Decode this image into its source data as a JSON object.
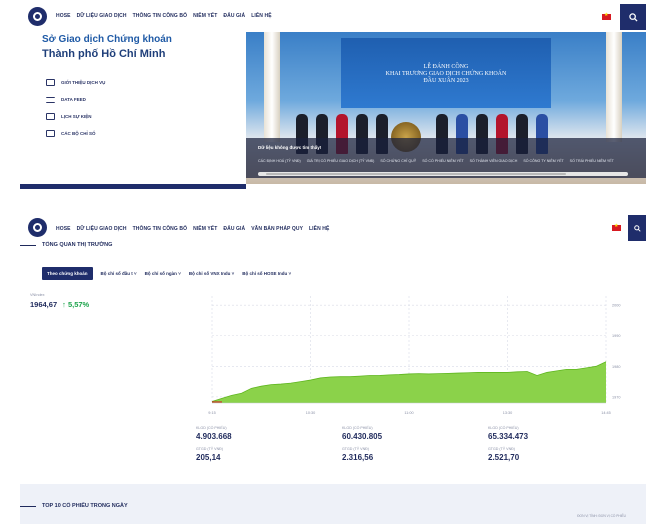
{
  "top": {
    "nav": [
      "HOSE",
      "DỮ LIỆU GIAO DỊCH",
      "THÔNG TIN CÔNG BỐ",
      "NIÊM YẾT",
      "ĐẤU GIÁ",
      "LIÊN HỆ"
    ],
    "hero_title_1": "Sở Giao dịch Chứng khoán",
    "hero_title_2": "Thành phố Hồ Chí Minh",
    "menu": [
      "GIỚI THIỆU DỊCH VỤ",
      "DATA FEED",
      "LỊCH SỰ KIỆN",
      "CÁC BỘ CHỈ SỐ"
    ],
    "photo_banner_line1": "LỄ ĐÁNH CỒNG",
    "photo_banner_line2": "KHAI TRƯƠNG GIAO DỊCH CHỨNG KHOÁN",
    "photo_banner_line3": "ĐẦU XUÂN 2023",
    "caption_title": "Dữ liệu không được tìm thấy!",
    "caption_items": [
      "CÁC ĐỊNH HOÁ (TỶ VNĐ)",
      "GIÁ TRỊ CỔ PHIẾU GIAO DỊCH (TỶ VNĐ)",
      "SỐ CHỨNG CHỈ QUỸ",
      "SỐ CỔ PHIẾU NIÊM YẾT",
      "SỐ THÀNH VIÊN GIAO DỊCH",
      "SỐ CÔNG TY NIÊM YẾT",
      "SỐ TRÁI PHIẾU NIÊM YẾT"
    ]
  },
  "bottom": {
    "nav": [
      "HOSE",
      "DỮ LIỆU GIAO DỊCH",
      "THÔNG TIN CÔNG BỐ",
      "NIÊM YẾT",
      "ĐẤU GIÁ",
      "VĂN BẢN PHÁP QUY",
      "LIÊN HỆ"
    ],
    "section_title": "TỔNG QUAN THỊ TRƯỜNG",
    "tabs": [
      "Theo chứng khoán",
      "Bộ chỉ số đầu t",
      "Bộ chỉ số ngàn",
      "Bộ chỉ số VNX Indu",
      "Bộ chỉ số HOSE Indu"
    ],
    "index_label": "VNIndex",
    "index_value": "1964,67",
    "index_change": "↑ 5,57%",
    "stats": [
      {
        "label": "KLGD (CỔ PHIẾU)",
        "value": "4.903.668"
      },
      {
        "label": "KLGD (CỔ PHIẾU)",
        "value": "60.430.805"
      },
      {
        "label": "KLGD (CỔ PHIẾU)",
        "value": "65.334.473"
      },
      {
        "label": "GTGD (TỶ VNĐ)",
        "value": "205,14"
      },
      {
        "label": "GTGD (TỶ VNĐ)",
        "value": "2.316,56"
      },
      {
        "label": "GTGD (TỶ VNĐ)",
        "value": "2.521,70"
      }
    ],
    "top10_title": "TOP 10 CỔ PHIẾU TRONG NGÀY",
    "top10_right": "ĐƠN VỊ TÍNH: ĐƠN VỊ CỔ PHIẾU"
  },
  "colors": {
    "navy": "#1f2d6b",
    "green_fill": "#8bd24a",
    "green_line": "#5fb61f",
    "up": "#1aa34a"
  },
  "chart_data": {
    "type": "area",
    "x_tick_labels": [
      "9:15",
      "10:30",
      "11:00",
      "13:30",
      "14:45"
    ],
    "y_tick_labels": [
      "2000",
      "1990",
      "1980",
      "1970"
    ],
    "ylim": [
      1968,
      2003
    ],
    "x": [
      0,
      1,
      2,
      3,
      4,
      5,
      6,
      7,
      8,
      9,
      10,
      11,
      12,
      13,
      14,
      15,
      16,
      17,
      18,
      19,
      20,
      21,
      22,
      23,
      24,
      25,
      26,
      27,
      28,
      29,
      30,
      31,
      32,
      33,
      34,
      35,
      36,
      37,
      38,
      39,
      40
    ],
    "values": [
      1968.5,
      1969.5,
      1970.5,
      1971.2,
      1972.8,
      1973.5,
      1974.0,
      1974.2,
      1974.5,
      1975.0,
      1975.5,
      1976.2,
      1976.5,
      1976.6,
      1976.6,
      1976.8,
      1977.0,
      1977.0,
      1977.2,
      1977.3,
      1977.5,
      1977.6,
      1977.5,
      1977.6,
      1977.7,
      1977.8,
      1977.9,
      1978.0,
      1978.0,
      1978.0,
      1978.0,
      1978.2,
      1978.3,
      1977.0,
      1978.0,
      1978.5,
      1979.0,
      1979.0,
      1979.5,
      1980.0,
      1981.5
    ],
    "series": [
      {
        "name": "VNIndex",
        "values": []
      }
    ],
    "grid": true
  }
}
